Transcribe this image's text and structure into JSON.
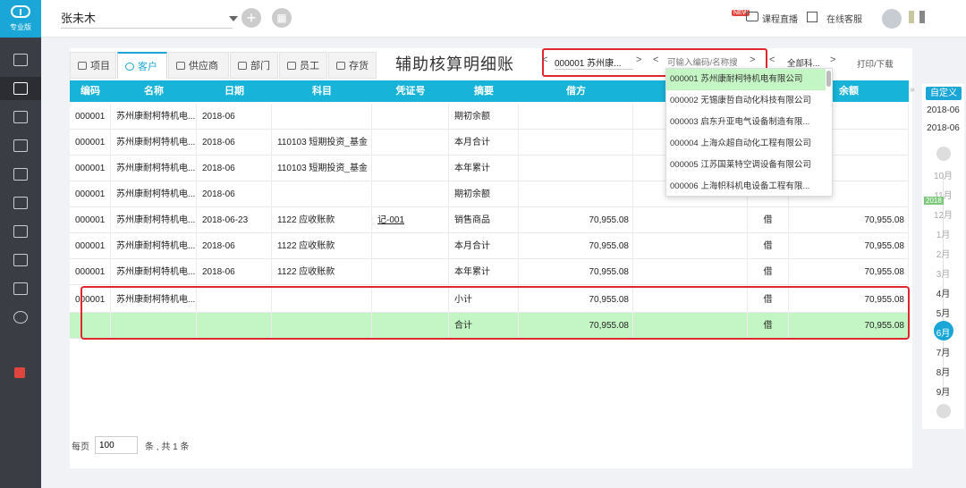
{
  "sidebar": {
    "version_label": "专业版"
  },
  "topbar": {
    "account": "张未木",
    "new_badge": "NEW",
    "live_course": "课程直播",
    "online_service": "在线客服"
  },
  "tabs": [
    {
      "label": "项目"
    },
    {
      "label": "客户"
    },
    {
      "label": "供应商"
    },
    {
      "label": "部门"
    },
    {
      "label": "员工"
    },
    {
      "label": "存货"
    }
  ],
  "page_title": "辅助核算明细账",
  "filter": {
    "selected_code": "000001 苏州康...",
    "search_placeholder": "可输入编码/名称搜",
    "all_label": "全部科...",
    "print_label": "打印/下载",
    "prev": "<",
    "next": ">"
  },
  "table": {
    "headers": [
      "编码",
      "名称",
      "日期",
      "科目",
      "凭证号",
      "摘要",
      "借方",
      "",
      "",
      "余额"
    ],
    "rows": [
      {
        "code": "000001",
        "name": "苏州康耐柯特机电...",
        "date": "2018-06",
        "subject": "",
        "voucher": "",
        "summary": "期初余额",
        "debit": "",
        "credit": "",
        "dir": "",
        "balance": ""
      },
      {
        "code": "000001",
        "name": "苏州康耐柯特机电...",
        "date": "2018-06",
        "subject": "110103 短期投资_基金",
        "voucher": "",
        "summary": "本月合计",
        "debit": "",
        "credit": "",
        "dir": "",
        "balance": ""
      },
      {
        "code": "000001",
        "name": "苏州康耐柯特机电...",
        "date": "2018-06",
        "subject": "110103 短期投资_基金",
        "voucher": "",
        "summary": "本年累计",
        "debit": "",
        "credit": "",
        "dir": "",
        "balance": ""
      },
      {
        "code": "000001",
        "name": "苏州康耐柯特机电...",
        "date": "2018-06",
        "subject": "",
        "voucher": "",
        "summary": "期初余额",
        "debit": "",
        "credit": "",
        "dir": "",
        "balance": ""
      },
      {
        "code": "000001",
        "name": "苏州康耐柯特机电...",
        "date": "2018-06-23",
        "subject": "1122 应收账款",
        "voucher": "记-001",
        "summary": "销售商品",
        "debit": "70,955.08",
        "credit": "",
        "dir": "借",
        "balance": "70,955.08"
      },
      {
        "code": "000001",
        "name": "苏州康耐柯特机电...",
        "date": "2018-06",
        "subject": "1122 应收账款",
        "voucher": "",
        "summary": "本月合计",
        "debit": "70,955.08",
        "credit": "",
        "dir": "借",
        "balance": "70,955.08"
      },
      {
        "code": "000001",
        "name": "苏州康耐柯特机电...",
        "date": "2018-06",
        "subject": "1122 应收账款",
        "voucher": "",
        "summary": "本年累计",
        "debit": "70,955.08",
        "credit": "",
        "dir": "借",
        "balance": "70,955.08"
      },
      {
        "code": "000001",
        "name": "苏州康耐柯特机电...",
        "date": "",
        "subject": "",
        "voucher": "",
        "summary": "小计",
        "debit": "70,955.08",
        "credit": "",
        "dir": "借",
        "balance": "70,955.08"
      },
      {
        "code": "",
        "name": "",
        "date": "",
        "subject": "",
        "voucher": "",
        "summary": "合计",
        "debit": "70,955.08",
        "credit": "",
        "dir": "借",
        "balance": "70,955.08"
      }
    ]
  },
  "dropdown": {
    "items": [
      "000001 苏州康耐柯特机电有限公司",
      "000002 无锡康哲自动化科技有限公司",
      "000003 启东升亚电气设备制造有限...",
      "000004 上海众超自动化工程有限公司",
      "000005 江苏国莱特空调设备有限公司",
      "000006 上海帜科机电设备工程有限..."
    ]
  },
  "pager": {
    "per_page_label": "每页",
    "per_page_value": "100",
    "summary": "条 , 共 1 条"
  },
  "rail": {
    "custom_label": "自定义",
    "start": "2018-06",
    "end": "2018-06",
    "year_tag": "2018",
    "months": [
      "10月",
      "11月",
      "12月",
      "1月",
      "2月",
      "3月",
      "4月",
      "5月",
      "6月",
      "7月",
      "8月",
      "9月"
    ],
    "selected_month": "6月"
  },
  "colors": {
    "accent": "#1aa7d8",
    "header": "#17b3d9",
    "highlight": "#e0262f",
    "total_row": "#c4f5c4"
  }
}
